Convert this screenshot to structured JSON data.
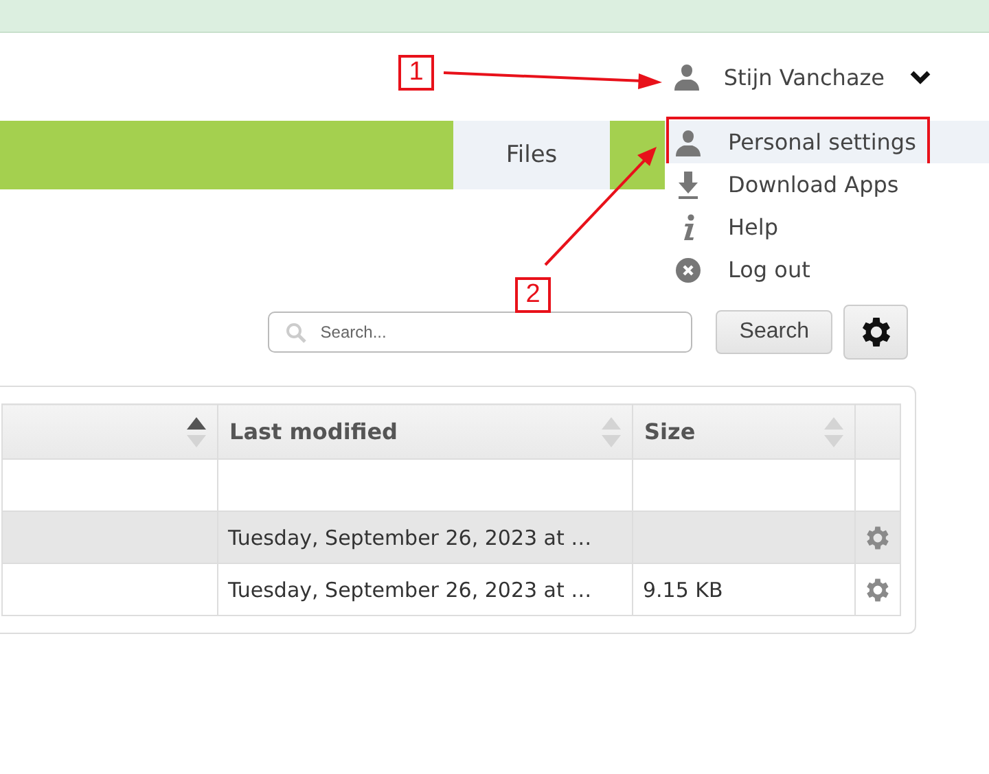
{
  "user_menu": {
    "name": "Stijn Vanchaze",
    "expanded": true
  },
  "nav": {
    "tabs": [
      {
        "label": "Files",
        "selected": true
      }
    ]
  },
  "dropdown": {
    "items": [
      {
        "label": "Personal settings",
        "kind": "user",
        "highlighted": true,
        "framed": true
      },
      {
        "label": "Download Apps",
        "kind": "download",
        "highlighted": false,
        "framed": false
      },
      {
        "label": "Help",
        "kind": "info",
        "highlighted": false,
        "framed": false
      },
      {
        "label": "Log out",
        "kind": "logout",
        "highlighted": false,
        "framed": false
      }
    ]
  },
  "toolbar": {
    "search": {
      "placeholder": "Search..."
    },
    "search_button": "Search"
  },
  "table": {
    "columns": [
      {
        "sorted": true
      },
      {
        "label": "Last modified",
        "sorted": false
      },
      {
        "label": "Size",
        "sorted": false
      },
      {}
    ],
    "rows": [
      {
        "last_modified": "Tuesday, September 26, 2023 at …",
        "highlighted": true,
        "actions": true
      },
      {
        "last_modified": "Tuesday, September 26, 2023 at …",
        "size": "9.15 KB",
        "highlighted": false,
        "actions": true
      }
    ]
  },
  "annotations": [
    {
      "label": "1"
    },
    {
      "label": "2"
    }
  ]
}
